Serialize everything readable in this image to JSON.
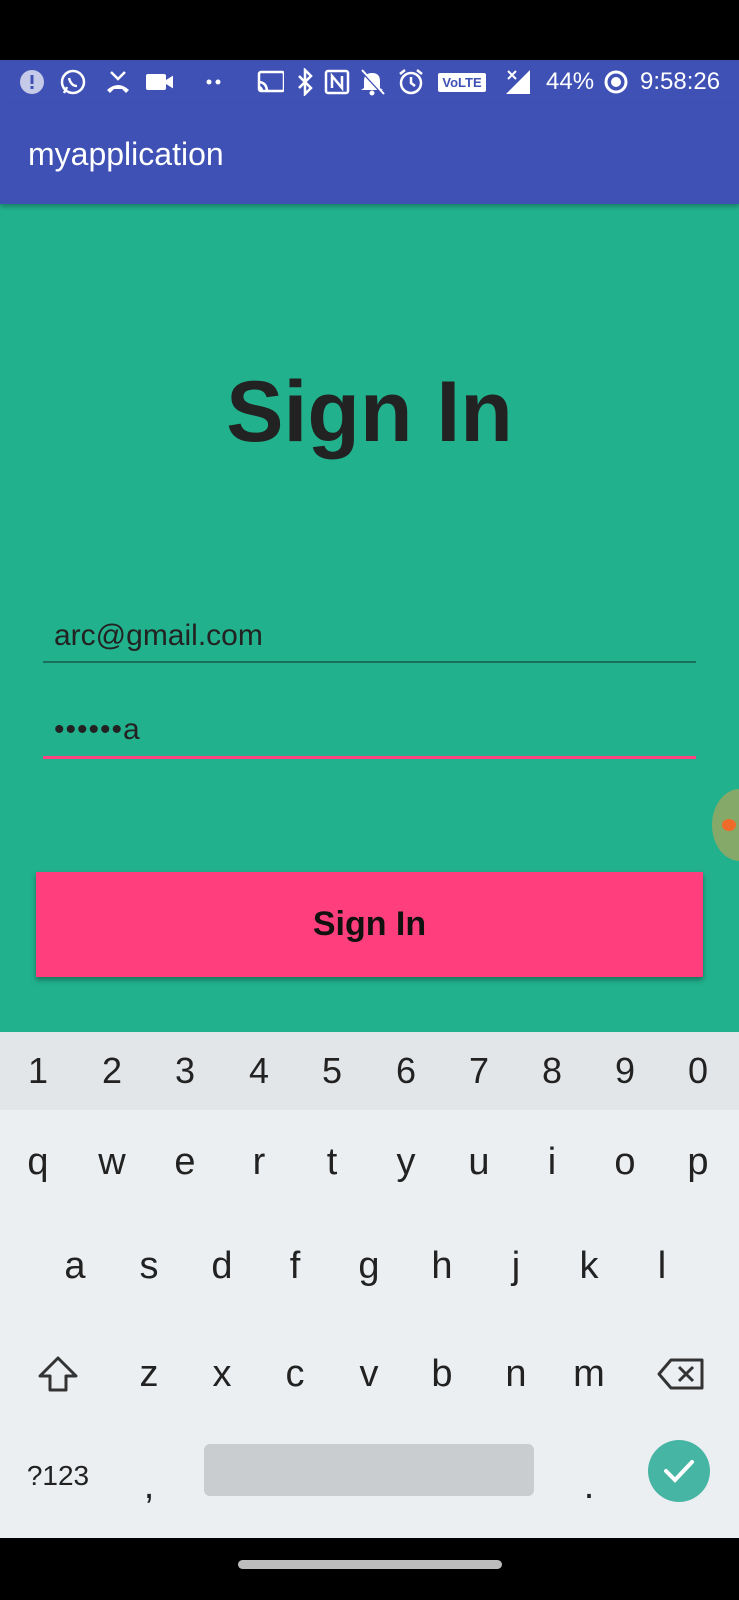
{
  "status_bar": {
    "icons": [
      "alert-icon",
      "whatsapp-icon",
      "missed-call-icon",
      "video-icon",
      "dots-icon",
      "cast-icon",
      "bluetooth-icon",
      "nfc-icon",
      "mute-icon",
      "alarm-icon",
      "volte-icon",
      "signal-icon",
      "battery-saver-icon"
    ],
    "volte_label": "VoLTE",
    "battery": "44%",
    "time": "9:58:26"
  },
  "app_bar": {
    "title": "myapplication"
  },
  "form": {
    "heading": "Sign In",
    "email_value": "arc@gmail.com",
    "password_value": "••••••a",
    "signin_label": "Sign In"
  },
  "keyboard": {
    "numbers": [
      "1",
      "2",
      "3",
      "4",
      "5",
      "6",
      "7",
      "8",
      "9",
      "0"
    ],
    "row1": [
      "q",
      "w",
      "e",
      "r",
      "t",
      "y",
      "u",
      "i",
      "o",
      "p"
    ],
    "row2": [
      "a",
      "s",
      "d",
      "f",
      "g",
      "h",
      "j",
      "k",
      "l"
    ],
    "row3": [
      "z",
      "x",
      "c",
      "v",
      "b",
      "n",
      "m"
    ],
    "symbols_label": "?123",
    "comma": ",",
    "period": "."
  },
  "colors": {
    "primary": "#3f51b5",
    "background": "#22b18d",
    "accent": "#ff4081",
    "button": "#ff3f7d",
    "enter": "#47b5a4"
  }
}
